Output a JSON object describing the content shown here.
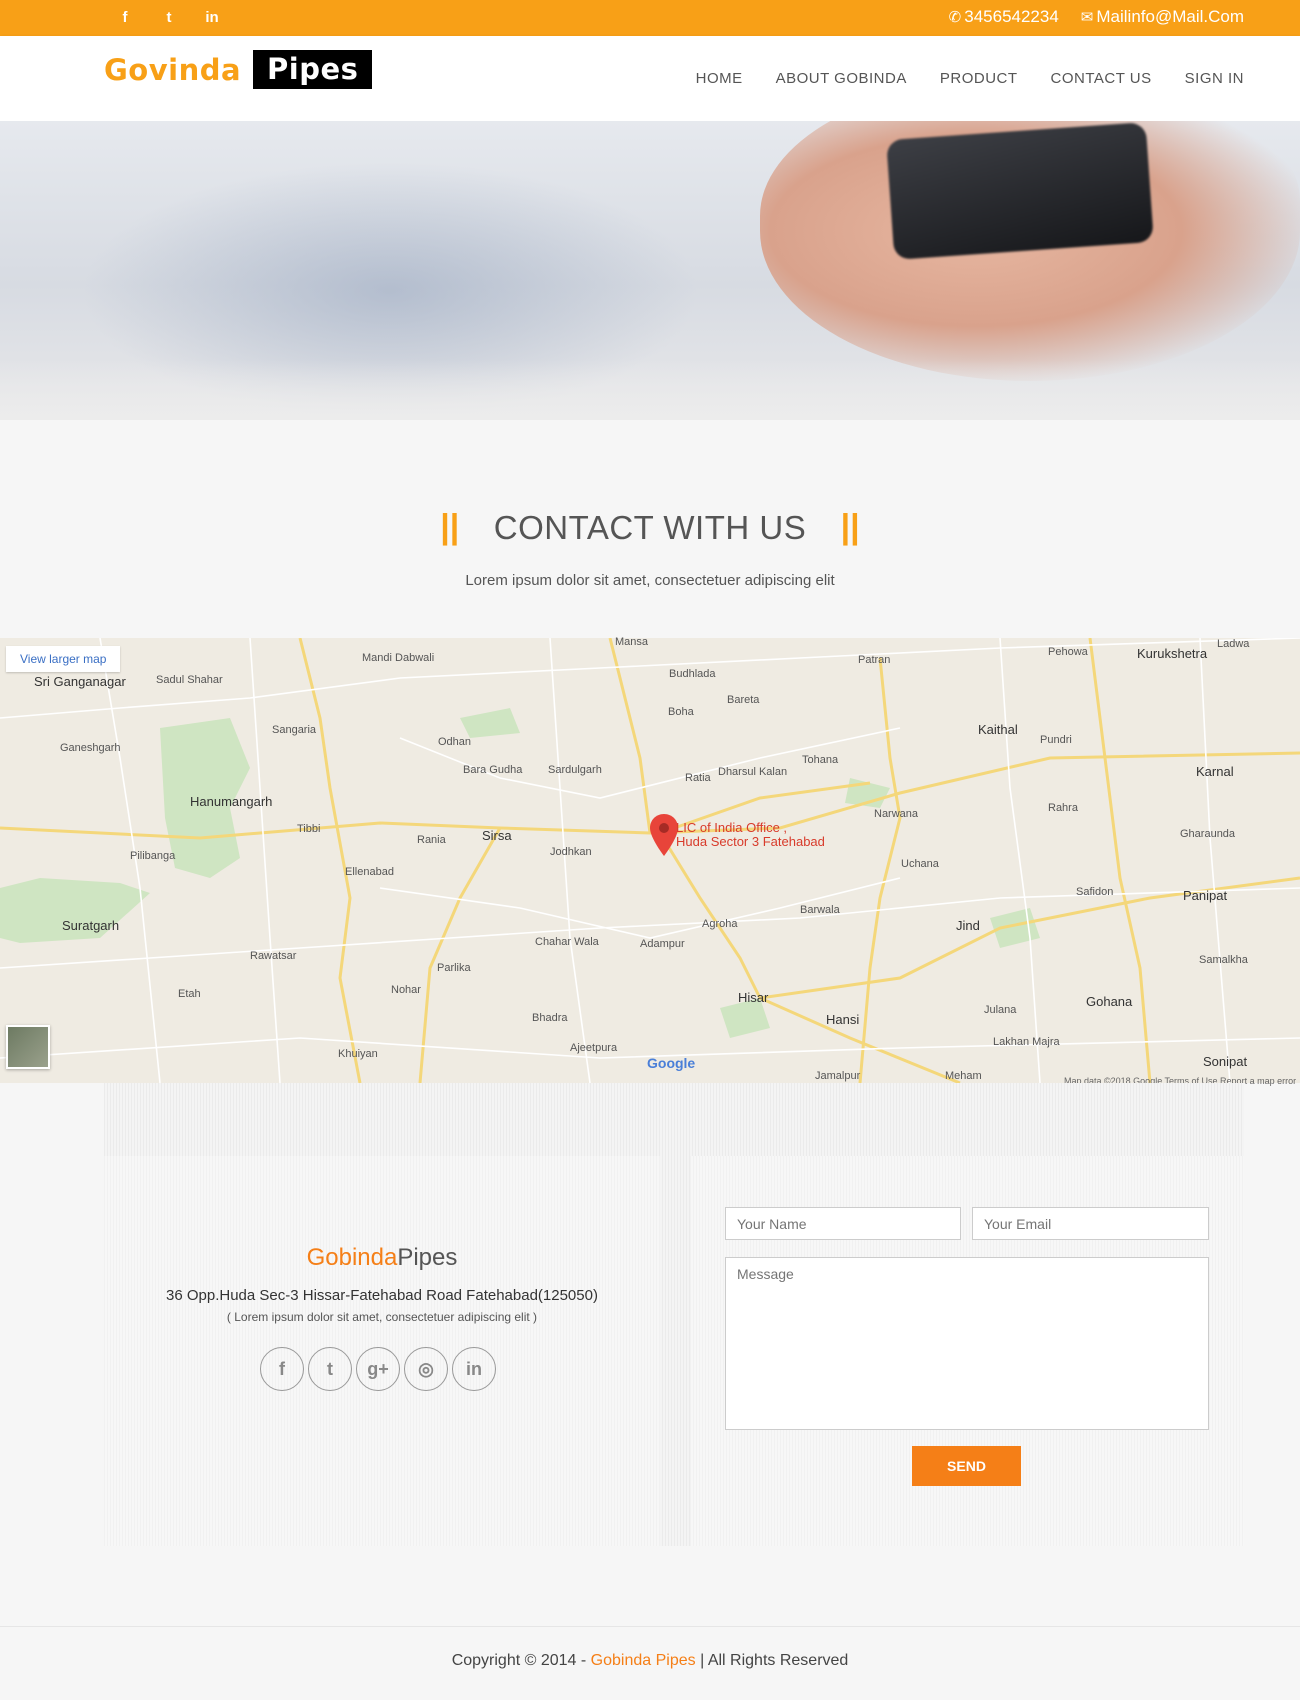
{
  "topbar": {
    "social": [
      {
        "name": "facebook-icon",
        "glyph": "f"
      },
      {
        "name": "twitter-icon",
        "glyph": "t"
      },
      {
        "name": "linkedin-icon",
        "glyph": "in"
      }
    ],
    "phone": "3456542234",
    "email": "Mailinfo@Mail.Com"
  },
  "header": {
    "logo_part1": "Govinda",
    "logo_part2": "Pipes",
    "nav": [
      "HOME",
      "ABOUT GOBINDA",
      "PRODUCT",
      "CONTACT US",
      "SIGN IN"
    ]
  },
  "section": {
    "title": "CONTACT WITH US",
    "bars": "||",
    "subtitle": "Lorem ipsum dolor sit amet, consectetuer adipiscing elit"
  },
  "map": {
    "view_larger": "View larger map",
    "marker_label_1": "LIC of India Office ,",
    "marker_label_2": "Huda Sector 3 Fatehabad",
    "google": "Google",
    "footer": "Map data ©2018 Google   Terms of Use   Report a map error",
    "places": [
      "Sri Ganganagar",
      "Sadul Shahar",
      "Mandi Dabwali",
      "Mansa",
      "Budhlada",
      "Patran",
      "Pehowa",
      "Kurukshetra",
      "Ladwa",
      "Bareta",
      "Boha",
      "Sangaria",
      "Odhan",
      "Bara Gudha",
      "Sardulgarh",
      "Ratia",
      "Dharsul Kalan",
      "Tohana",
      "Kaithal",
      "Pundri",
      "Karnal",
      "Ganeshgarh",
      "Hanumangarh",
      "Tibbi",
      "Rania",
      "Sirsa",
      "Jodhkan",
      "Narwana",
      "Rahra",
      "Gharaunda",
      "Pilibanga",
      "Ellenabad",
      "Uchana",
      "Safidon",
      "Panipat",
      "Suratgarh",
      "Agroha",
      "Barwala",
      "Jind",
      "Chahar Wala",
      "Adampur",
      "Rawatsar",
      "Parlika",
      "Samalkha",
      "Etah",
      "Nohar",
      "Hisar",
      "Bhadra",
      "Hansi",
      "Julana",
      "Gohana",
      "Lakhan Majra",
      "Khuiyan",
      "Ajeetpura",
      "Jamalpur",
      "Meham",
      "Sonipat"
    ]
  },
  "contact": {
    "brand_orange": "Gobinda",
    "brand_dark": "Pipes",
    "address": "36 Opp.Huda Sec-3 Hissar-Fatehabad Road Fatehabad(125050)",
    "address_note": "( Lorem ipsum dolor sit amet, consectetuer adipiscing elit )",
    "socials": [
      {
        "name": "facebook-icon",
        "glyph": "f"
      },
      {
        "name": "twitter-icon",
        "glyph": "t"
      },
      {
        "name": "google-plus-icon",
        "glyph": "g+"
      },
      {
        "name": "dribbble-icon",
        "glyph": "◎"
      },
      {
        "name": "linkedin-icon",
        "glyph": "in"
      }
    ],
    "form": {
      "name_placeholder": "Your Name",
      "email_placeholder": "Your Email",
      "message_placeholder": "Message",
      "send_label": "SEND"
    }
  },
  "footer": {
    "prefix": "Copyright © 2014 -",
    "brand": "Gobinda Pipes",
    "suffix": "| All Rights Reserved"
  },
  "colors": {
    "accent": "#f8a017",
    "button": "#f57f17",
    "background": "#f6f6f6"
  }
}
